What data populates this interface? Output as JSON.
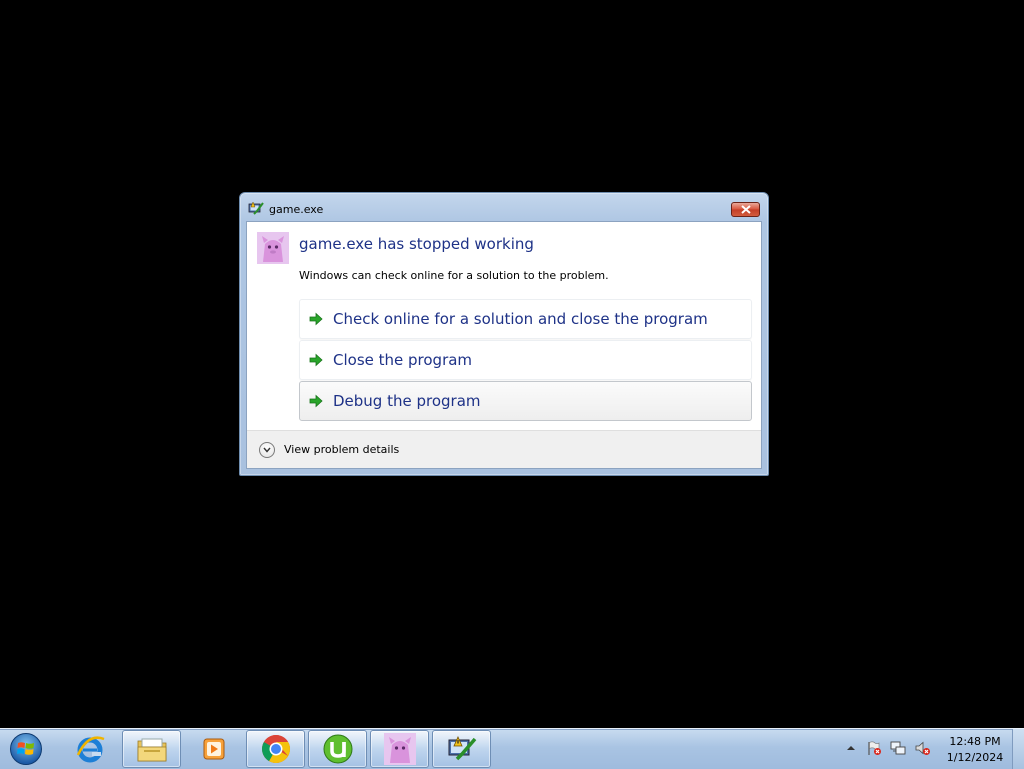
{
  "dialog": {
    "title": "game.exe",
    "headline": "game.exe has stopped working",
    "message": "Windows can check online for a solution to the problem.",
    "options": [
      {
        "label": "Check online for a solution and close the program"
      },
      {
        "label": "Close the program"
      },
      {
        "label": "Debug the program"
      }
    ],
    "details_label": "View problem details"
  },
  "taskbar": {
    "pinned": [
      {
        "name": "internet-explorer"
      },
      {
        "name": "windows-explorer"
      },
      {
        "name": "windows-media-player"
      },
      {
        "name": "google-chrome"
      },
      {
        "name": "utorrent"
      },
      {
        "name": "game"
      },
      {
        "name": "error-reporting"
      }
    ],
    "clock": {
      "time": "12:48 PM",
      "date": "1/12/2024"
    }
  },
  "colors": {
    "desktop": "#000000",
    "title_blue": "#1e3287",
    "arrow_green": "#2aa52a"
  }
}
